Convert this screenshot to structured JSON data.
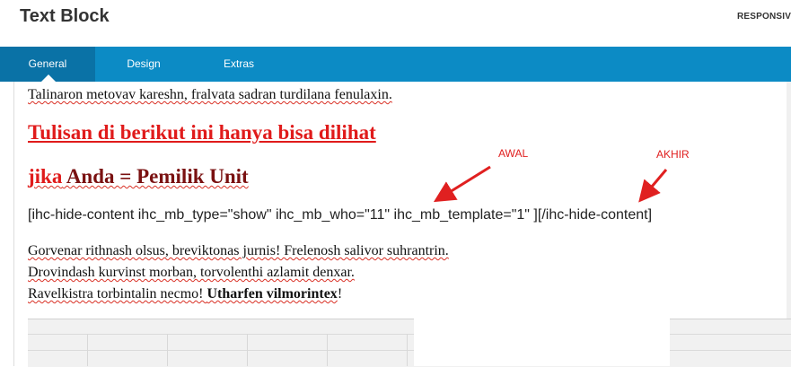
{
  "header": {
    "title": "Text Block",
    "responsive_label": "RESPONSIV"
  },
  "tabs": [
    {
      "label": "General",
      "active": true
    },
    {
      "label": "Design",
      "active": false
    },
    {
      "label": "Extras",
      "active": false
    }
  ],
  "content": {
    "para1": "Talinaron metovav kareshn, fralvata sadran turdilana fenulaxin.",
    "heading1": "Tulisan di berikut ini hanya bisa dilihat",
    "heading2_red": "jika",
    "heading2_rest": " Anda = Pemilik Unit",
    "shortcode": "[ihc-hide-content ihc_mb_type=\"show\" ihc_mb_who=\"11\" ihc_mb_template=\"1\" ][/ihc-hide-content]",
    "para2_lines": [
      "Gorvenar rithnash olsus, breviktonas jurnis! Frelenosh salivor suhrantrin.",
      "Drovindash kurvinst morban, torvolenthi azlamit denxar."
    ],
    "para3_start": "Ravelkistra torbintalin necmo! ",
    "para3_bold": "Utharfen vilmorintex",
    "para3_end": "!"
  },
  "annotations": {
    "awal": "AWAL",
    "akhir": "AKHIR",
    "color": "#e02020"
  },
  "colors": {
    "tab_bar": "#0c8bc5",
    "tab_active": "#0a72a6",
    "heading_red": "#e01b1b",
    "heading_dark_red": "#7a1111"
  }
}
